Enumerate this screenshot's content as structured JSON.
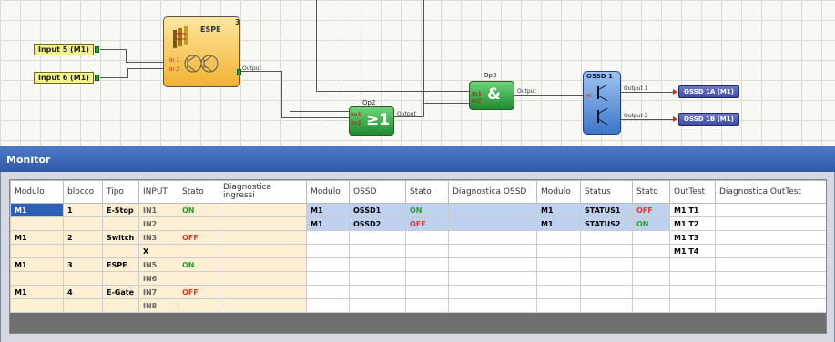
{
  "canvas": {
    "inputs": [
      "Input 5 (M1)",
      "Input 6 (M1)"
    ],
    "espe": {
      "title": "ESPE",
      "number": "3",
      "pins_in": [
        "In 1",
        "In 2"
      ],
      "pin_out": "Output"
    },
    "op2": {
      "name": "Op2",
      "symbol": "≥1",
      "pins_in": [
        "In1",
        "In2"
      ],
      "pin_out": "Output"
    },
    "op3": {
      "name": "Op3",
      "symbol": "&",
      "pins_in": [
        "In1",
        "In2"
      ],
      "pin_out": "Output"
    },
    "ossd": {
      "title": "OSSD 1",
      "pin_in": "In",
      "pin_out1": "Output 1",
      "pin_out2": "Output 2"
    },
    "outputs": [
      "OSSD 1A (M1)",
      "OSSD 1B (M1)"
    ]
  },
  "monitor": {
    "title": "Monitor",
    "headers": [
      "Modulo",
      "blocco",
      "Tipo",
      "INPUT",
      "Stato",
      "Diagnostica ingressi",
      "Modulo",
      "OSSD",
      "Stato",
      "Diagnostica OSSD",
      "Modulo",
      "Status",
      "Stato",
      "OutTest",
      "Diagnostica OutTest"
    ],
    "rows": [
      [
        "M1",
        "1",
        "E-Stop",
        "IN1",
        "ON",
        "",
        "M1",
        "OSSD1",
        "ON",
        "",
        "M1",
        "STATUS1",
        "OFF",
        "M1 T1",
        ""
      ],
      [
        "",
        "",
        "",
        "IN2",
        "",
        "",
        "M1",
        "OSSD2",
        "OFF",
        "",
        "M1",
        "STATUS2",
        "ON",
        "M1 T2",
        ""
      ],
      [
        "M1",
        "2",
        "Switch",
        "IN3",
        "OFF",
        "",
        "",
        "",
        "",
        "",
        "",
        "",
        "",
        "M1 T3",
        ""
      ],
      [
        "",
        "",
        "",
        "X",
        "",
        "",
        "",
        "",
        "",
        "",
        "",
        "",
        "",
        "M1 T4",
        ""
      ],
      [
        "M1",
        "3",
        "ESPE",
        "IN5",
        "ON",
        "",
        "",
        "",
        "",
        "",
        "",
        "",
        "",
        "",
        ""
      ],
      [
        "",
        "",
        "",
        "IN6",
        "",
        "",
        "",
        "",
        "",
        "",
        "",
        "",
        "",
        "",
        ""
      ],
      [
        "M1",
        "4",
        "E-Gate",
        "IN7",
        "OFF",
        "",
        "",
        "",
        "",
        "",
        "",
        "",
        "",
        "",
        ""
      ],
      [
        "",
        "",
        "",
        "IN8",
        "",
        "",
        "",
        "",
        "",
        "",
        "",
        "",
        "",
        "",
        ""
      ]
    ]
  },
  "colors": {
    "on": "#2c9c32",
    "off": "#e03b2e",
    "monitor_bar": "#3d67b8",
    "input_fill": "#fcefd3",
    "ossd_fill": "#bed1ee"
  }
}
